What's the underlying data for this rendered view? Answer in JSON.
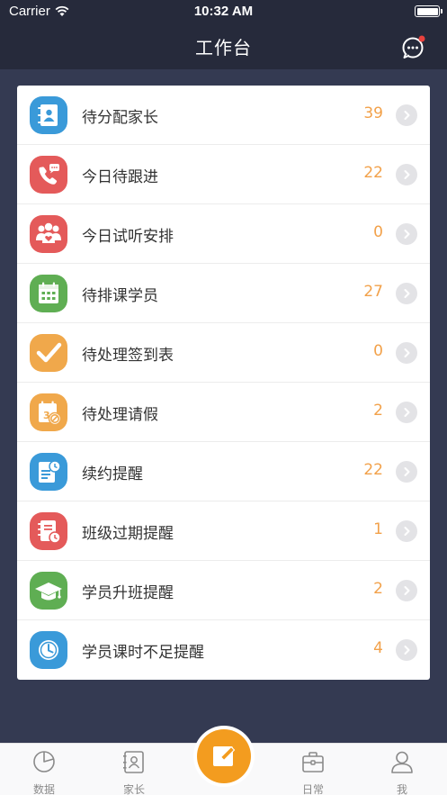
{
  "status_bar": {
    "carrier": "Carrier",
    "time": "10:32 AM"
  },
  "nav": {
    "title": "工作台",
    "chat_icon": "chat-bubble-icon"
  },
  "tasks": [
    {
      "label": "待分配家长",
      "count": "39",
      "icon": "contact-book-icon",
      "color": "#3a9ad9"
    },
    {
      "label": "今日待跟进",
      "count": "22",
      "icon": "phone-call-icon",
      "color": "#e45a5a"
    },
    {
      "label": "今日试听安排",
      "count": "0",
      "icon": "group-heart-icon",
      "color": "#e45a5a"
    },
    {
      "label": "待排课学员",
      "count": "27",
      "icon": "calendar-icon",
      "color": "#5fae53"
    },
    {
      "label": "待处理签到表",
      "count": "0",
      "icon": "checkmark-icon",
      "color": "#f0a84b"
    },
    {
      "label": "待处理请假",
      "count": "2",
      "icon": "calendar-cancel-icon",
      "color": "#f0a84b"
    },
    {
      "label": "续约提醒",
      "count": "22",
      "icon": "document-clock-icon",
      "color": "#3a9ad9"
    },
    {
      "label": "班级过期提醒",
      "count": "1",
      "icon": "notebook-clock-icon",
      "color": "#e45a5a"
    },
    {
      "label": "学员升班提醒",
      "count": "2",
      "icon": "graduation-cap-icon",
      "color": "#5fae53"
    },
    {
      "label": "学员课时不足提醒",
      "count": "4",
      "icon": "clock-icon",
      "color": "#3a9ad9"
    }
  ],
  "tabs": [
    {
      "label": "数据",
      "icon": "pie-chart-icon"
    },
    {
      "label": "家长",
      "icon": "contact-card-icon"
    },
    {
      "label": "日常",
      "icon": "briefcase-icon"
    },
    {
      "label": "我",
      "icon": "person-icon"
    }
  ],
  "center_button": {
    "icon": "edit-pencil-icon",
    "color": "#f39c1f"
  },
  "colors": {
    "nav_bg": "#262a3b",
    "content_bg": "#343a52",
    "count_accent": "#f2a14a"
  }
}
